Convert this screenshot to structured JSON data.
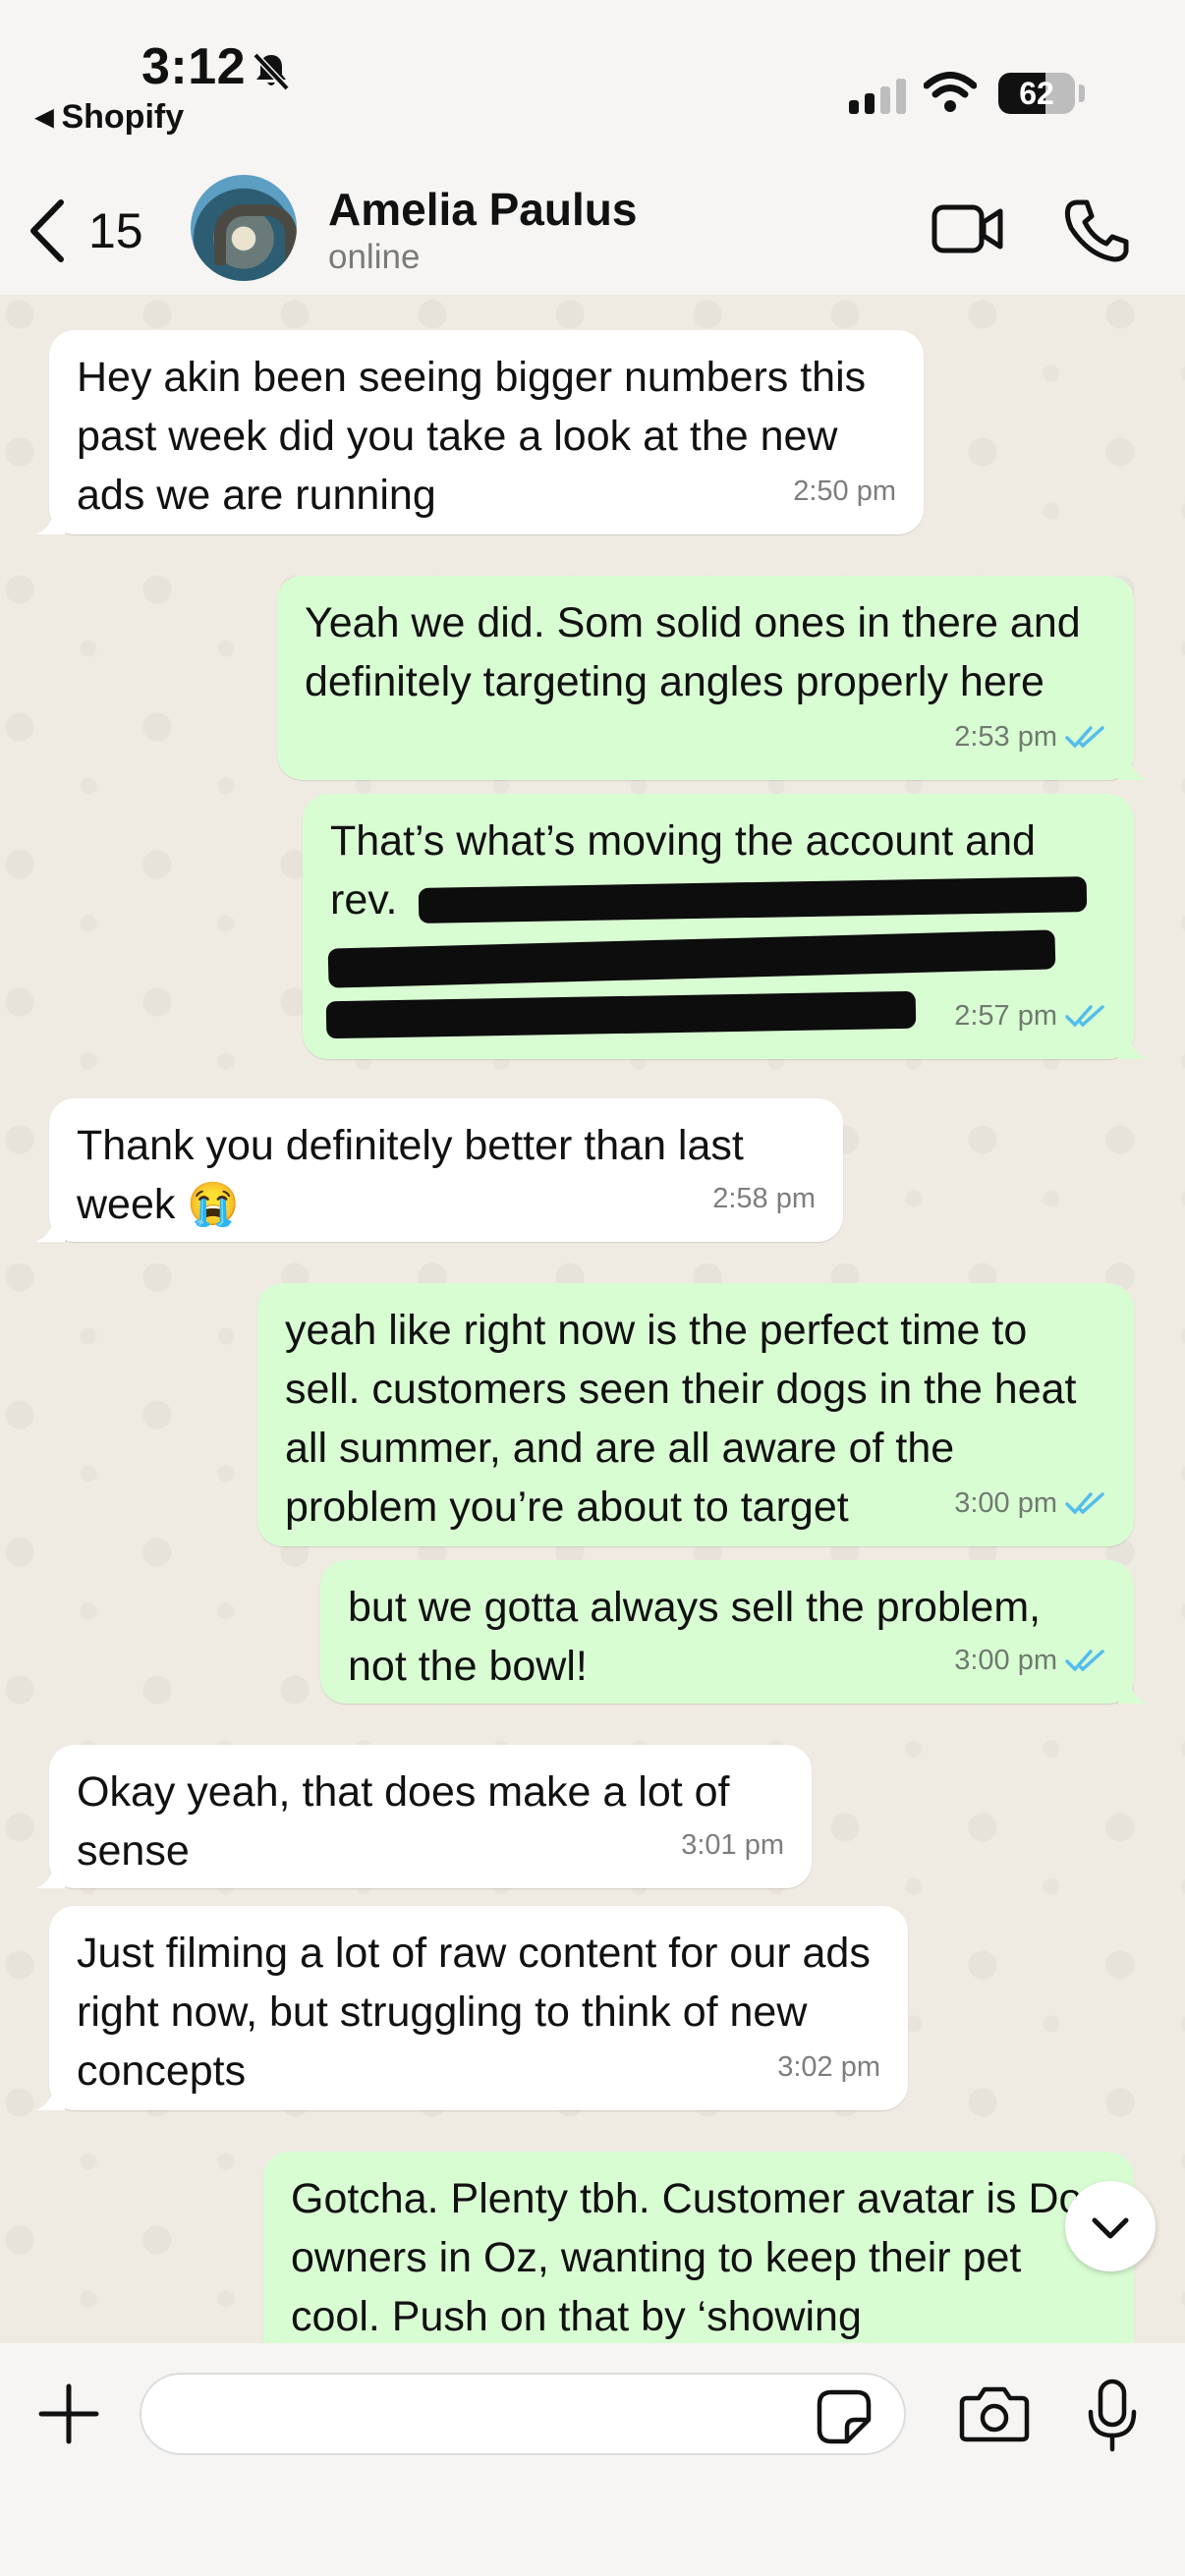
{
  "status_bar": {
    "time": "3:12",
    "back_app": "Shopify",
    "battery": "62",
    "battery_level": 0.62
  },
  "header": {
    "back_count": "15",
    "contact_name": "Amelia Paulus",
    "contact_status": "online"
  },
  "messages": [
    {
      "dir": "in",
      "text": "Hey akin been seeing bigger numbers this past week did you take a look at the new ads we are running",
      "time": "2:50 pm"
    },
    {
      "dir": "out",
      "text": "Yeah we did. Som solid ones in there and definitely targeting angles properly here",
      "time": "2:53 pm",
      "read": true
    },
    {
      "dir": "out",
      "text": "That’s what’s moving the account and rev.",
      "time": "2:57 pm",
      "read": true,
      "redacted": true
    },
    {
      "dir": "in",
      "text": "Thank you definitely better than last week 😭",
      "time": "2:58 pm"
    },
    {
      "dir": "out",
      "text": "yeah like right now is the perfect time to sell. customers seen their dogs in the heat all summer, and are all aware of the problem you’re about to target",
      "time": "3:00 pm",
      "read": true
    },
    {
      "dir": "out",
      "text": "but we gotta always sell the problem, not the bowl!",
      "time": "3:00 pm",
      "read": true
    },
    {
      "dir": "in",
      "text": "Okay yeah, that does make a lot of sense",
      "time": "3:01 pm"
    },
    {
      "dir": "in",
      "text": "Just filming a lot of raw content for our ads right now, but struggling to think of new concepts",
      "time": "3:02 pm"
    },
    {
      "dir": "out",
      "text": "Gotcha. Plenty tbh. Customer avatar is Dog owners in Oz, wanting to keep their pet cool. Push on that by ‘showing",
      "time": "",
      "read": false
    }
  ],
  "composer": {
    "placeholder": ""
  },
  "colors": {
    "incoming_bubble": "#ffffff",
    "outgoing_bubble": "#d9fdd3",
    "read_tick": "#53bdeb",
    "chat_background": "#efeae2"
  },
  "icons": [
    "bell-slash-icon",
    "cellular-signal-icon",
    "wifi-icon",
    "battery-icon",
    "chevron-left-icon",
    "video-call-icon",
    "phone-icon",
    "double-check-icon",
    "chevron-down-icon",
    "plus-icon",
    "sticker-icon",
    "camera-icon",
    "microphone-icon"
  ]
}
